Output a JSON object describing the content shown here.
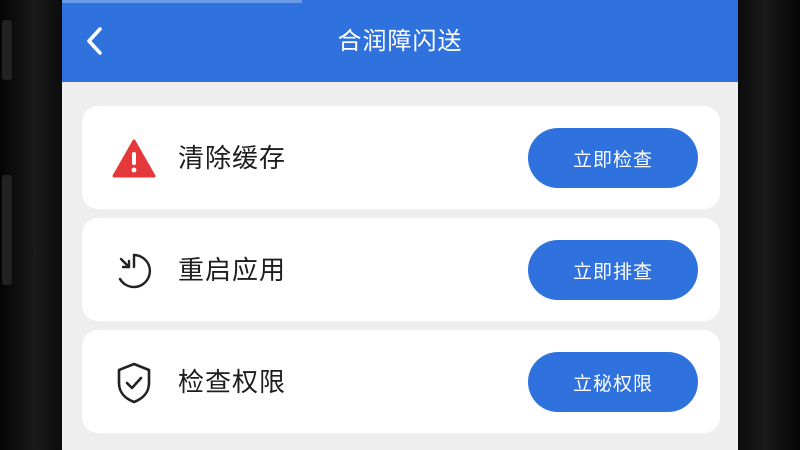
{
  "header": {
    "title": "合润障闪送",
    "back_icon": "chevron-left-icon",
    "color": "#2f72de"
  },
  "items": [
    {
      "label": "清除缓存",
      "icon": "warning-triangle-icon",
      "icon_color": "#e5383b",
      "button_label": "立即检查"
    },
    {
      "label": "重启应用",
      "icon": "restart-timer-icon",
      "icon_color": "#222222",
      "button_label": "立即排查"
    },
    {
      "label": "检查权限",
      "icon": "shield-check-icon",
      "icon_color": "#222222",
      "button_label": "立秘权限"
    }
  ]
}
